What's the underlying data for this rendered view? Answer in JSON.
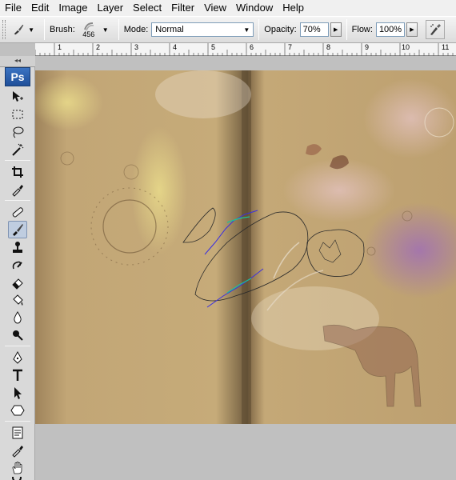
{
  "menu": [
    "File",
    "Edit",
    "Image",
    "Layer",
    "Select",
    "Filter",
    "View",
    "Window",
    "Help"
  ],
  "options": {
    "brush_label": "Brush:",
    "brush_size": "456",
    "mode_label": "Mode:",
    "mode_value": "Normal",
    "opacity_label": "Opacity:",
    "opacity_value": "70%",
    "flow_label": "Flow:",
    "flow_value": "100%"
  },
  "ruler": {
    "numbers": [
      "1",
      "2",
      "3",
      "4",
      "5",
      "6",
      "7",
      "8",
      "9",
      "10",
      "11"
    ]
  },
  "toolbox": {
    "logo": "Ps",
    "active_tool": "brush-tool"
  },
  "colors": {
    "paper_light": "#c9ac7a",
    "paper_dark": "#8d7149",
    "selection_path": "#2a2a2a",
    "selection_blue": "#3b2fe0",
    "selection_green": "#19c29a",
    "stain_purple": "#a06fb5",
    "stain_yellow": "#e4d78a",
    "stain_brown": "#7a4a34"
  }
}
